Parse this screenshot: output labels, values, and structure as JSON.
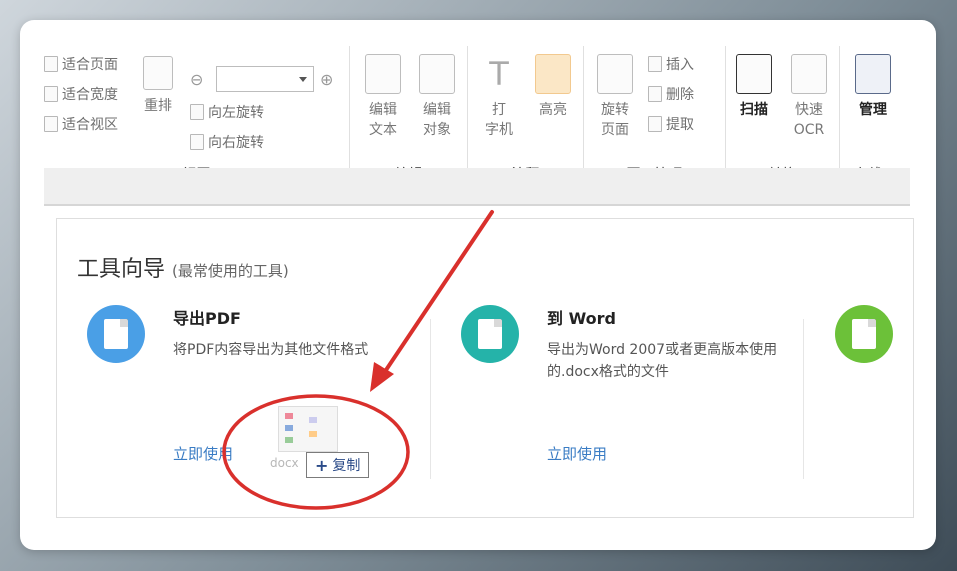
{
  "ribbon": {
    "view": {
      "label": "视图",
      "fit_page": "适合页面",
      "fit_width": "适合宽度",
      "fit_visible": "适合视区",
      "reflow": "重排",
      "rotate_left": "向左旋转",
      "rotate_right": "向右旋转",
      "zoom_value": ""
    },
    "edit": {
      "label": "编辑",
      "edit_text": [
        "编辑",
        "文本"
      ],
      "edit_object": [
        "编辑",
        "对象"
      ]
    },
    "annotate": {
      "label": "注释",
      "typewriter": [
        "打",
        "字机"
      ],
      "highlight": "高亮"
    },
    "page_manage": {
      "label": "页面管理",
      "rotate_page": [
        "旋转",
        "页面"
      ],
      "insert": "插入",
      "delete": "删除",
      "extract": "提取"
    },
    "convert": {
      "label": "转换",
      "scan": "扫描",
      "quick_ocr": [
        "快速",
        "OCR"
      ]
    },
    "online": {
      "label": "在线...",
      "manage": "管理"
    }
  },
  "tool_guide": {
    "title": "工具向导",
    "subtitle": "(最常使用的工具)",
    "tools": [
      {
        "name": "导出PDF",
        "desc": "将PDF内容导出为其他文件格式",
        "link": "立即使用",
        "color": "#4a9fe6"
      },
      {
        "name": "到 Word",
        "desc": "导出为Word 2007或者更高版本使用的.docx格式的文件",
        "link": "立即使用",
        "color": "#25b3a9"
      },
      {
        "name": "",
        "desc": "",
        "link": "",
        "color": "#6cc139"
      }
    ]
  },
  "drag": {
    "copy_label": "复制",
    "caption": "docx"
  },
  "colors": {
    "annotation_red": "#d9302c",
    "link_blue": "#3a7cc4"
  }
}
